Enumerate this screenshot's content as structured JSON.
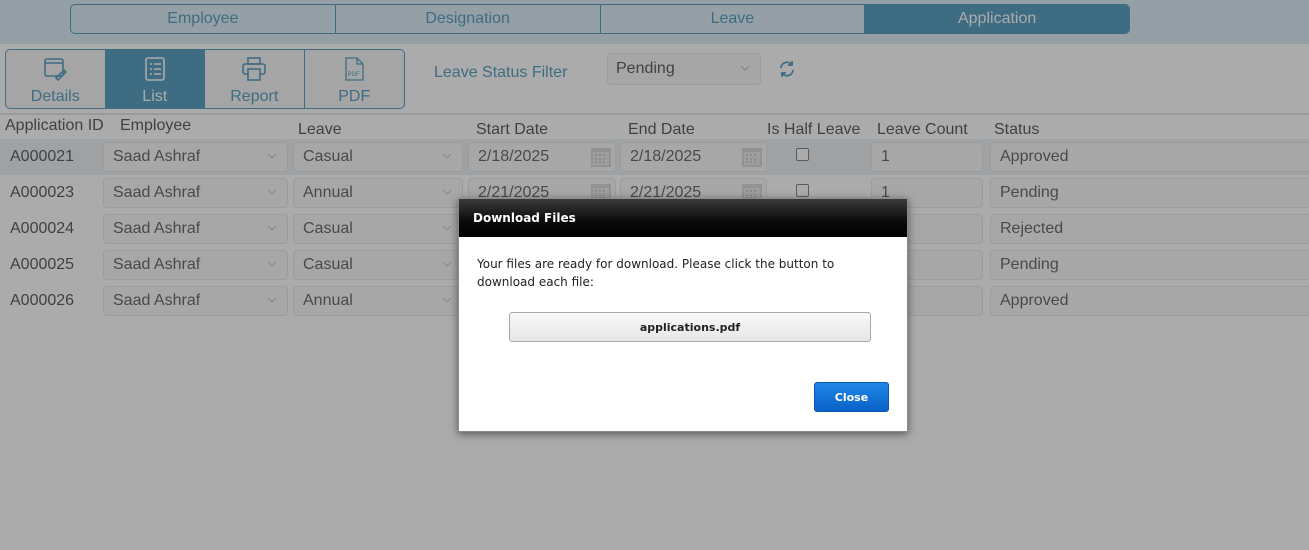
{
  "nav_tabs": [
    {
      "label": "Employee",
      "active": false
    },
    {
      "label": "Designation",
      "active": false
    },
    {
      "label": "Leave",
      "active": false
    },
    {
      "label": "Application",
      "active": true
    }
  ],
  "toolbar": {
    "buttons": [
      {
        "label": "Details",
        "icon": "window-edit-icon",
        "active": false
      },
      {
        "label": "List",
        "icon": "list-icon",
        "active": true
      },
      {
        "label": "Report",
        "icon": "printer-icon",
        "active": false
      },
      {
        "label": "PDF",
        "icon": "pdf-file-icon",
        "active": false
      }
    ]
  },
  "filter": {
    "label": "Leave Status Filter",
    "selected": "Pending",
    "refresh_icon": "refresh-icon"
  },
  "grid": {
    "columns": [
      "Application ID",
      "Employee",
      "Leave",
      "Start Date",
      "End Date",
      "Is Half Leave",
      "Leave Count",
      "Status"
    ],
    "rows": [
      {
        "id": "A000021",
        "employee": "Saad Ashraf",
        "leave": "Casual",
        "start": "2/18/2025",
        "end": "2/18/2025",
        "half": false,
        "count": "1",
        "status": "Approved"
      },
      {
        "id": "A000023",
        "employee": "Saad Ashraf",
        "leave": "Annual",
        "start": "2/21/2025",
        "end": "2/21/2025",
        "half": false,
        "count": "1",
        "status": "Pending"
      },
      {
        "id": "A000024",
        "employee": "Saad Ashraf",
        "leave": "Casual",
        "start": "",
        "end": "",
        "half": false,
        "count": "",
        "status": "Rejected"
      },
      {
        "id": "A000025",
        "employee": "Saad Ashraf",
        "leave": "Casual",
        "start": "",
        "end": "",
        "half": false,
        "count": "",
        "status": "Pending"
      },
      {
        "id": "A000026",
        "employee": "Saad Ashraf",
        "leave": "Annual",
        "start": "",
        "end": "",
        "half": false,
        "count": "",
        "status": "Approved"
      }
    ]
  },
  "dialog": {
    "title": "Download Files",
    "message": "Your files are ready for download. Please click the button to download each file:",
    "files": [
      "applications.pdf"
    ],
    "close_label": "Close"
  },
  "colors": {
    "accent": "#2e87b3",
    "close_button": "#0a62c8"
  }
}
